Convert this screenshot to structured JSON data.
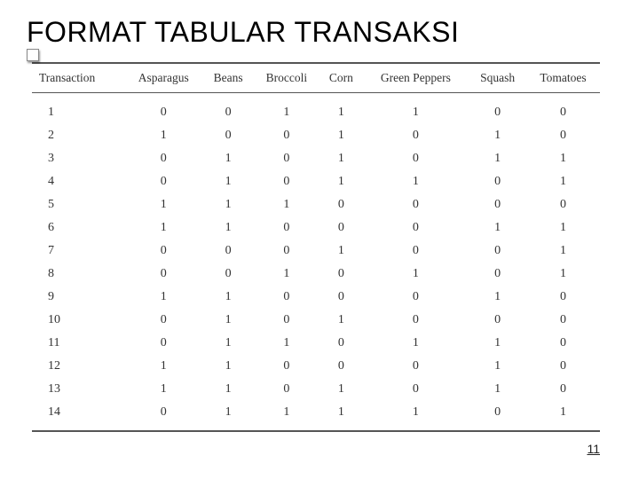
{
  "title": "FORMAT TABULAR TRANSAKSI",
  "page_number": "11",
  "chart_data": {
    "type": "table",
    "columns": [
      "Transaction",
      "Asparagus",
      "Beans",
      "Broccoli",
      "Corn",
      "Green Peppers",
      "Squash",
      "Tomatoes"
    ],
    "rows": [
      [
        "1",
        "0",
        "0",
        "1",
        "1",
        "1",
        "0",
        "0"
      ],
      [
        "2",
        "1",
        "0",
        "0",
        "1",
        "0",
        "1",
        "0"
      ],
      [
        "3",
        "0",
        "1",
        "0",
        "1",
        "0",
        "1",
        "1"
      ],
      [
        "4",
        "0",
        "1",
        "0",
        "1",
        "1",
        "0",
        "1"
      ],
      [
        "5",
        "1",
        "1",
        "1",
        "0",
        "0",
        "0",
        "0"
      ],
      [
        "6",
        "1",
        "1",
        "0",
        "0",
        "0",
        "1",
        "1"
      ],
      [
        "7",
        "0",
        "0",
        "0",
        "1",
        "0",
        "0",
        "1"
      ],
      [
        "8",
        "0",
        "0",
        "1",
        "0",
        "1",
        "0",
        "1"
      ],
      [
        "9",
        "1",
        "1",
        "0",
        "0",
        "0",
        "1",
        "0"
      ],
      [
        "10",
        "0",
        "1",
        "0",
        "1",
        "0",
        "0",
        "0"
      ],
      [
        "11",
        "0",
        "1",
        "1",
        "0",
        "1",
        "1",
        "0"
      ],
      [
        "12",
        "1",
        "1",
        "0",
        "0",
        "0",
        "1",
        "0"
      ],
      [
        "13",
        "1",
        "1",
        "0",
        "1",
        "0",
        "1",
        "0"
      ],
      [
        "14",
        "0",
        "1",
        "1",
        "1",
        "1",
        "0",
        "1"
      ]
    ]
  }
}
